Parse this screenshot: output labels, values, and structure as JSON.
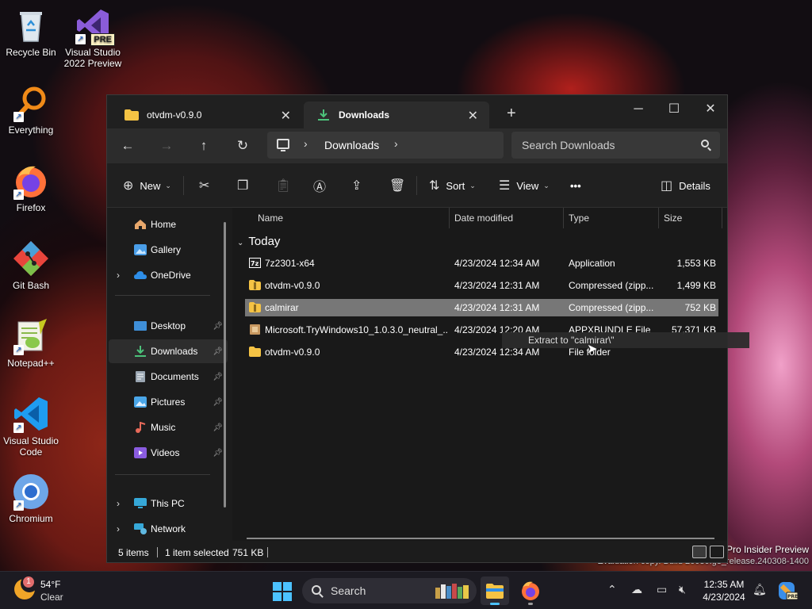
{
  "desktop": {
    "icons": [
      {
        "label": "Recycle Bin"
      },
      {
        "label": "Visual Studio 2022 Preview",
        "line1": "Visual Studio",
        "line2": "2022 Preview",
        "badge": "PRE"
      },
      {
        "label": "Everything"
      },
      {
        "label": "Firefox"
      },
      {
        "label": "Git Bash"
      },
      {
        "label": "Notepad++"
      },
      {
        "label": "Visual Studio Code",
        "line1": "Visual Studio",
        "line2": "Code"
      },
      {
        "label": "Chromium"
      }
    ],
    "watermark_line1": "Pro Insider Preview",
    "watermark_line2": "Evaluation copy. Build 26080.ge_release.240308-1400"
  },
  "explorer": {
    "tabs": [
      {
        "label": "otvdm-v0.9.0",
        "icon": "folder-icon",
        "active": false
      },
      {
        "label": "Downloads",
        "icon": "download-icon",
        "active": true
      }
    ],
    "address": {
      "crumb": "Downloads"
    },
    "search": {
      "placeholder": "Search Downloads"
    },
    "toolbar": {
      "new_label": "New",
      "sort_label": "Sort",
      "view_label": "View",
      "more_label": "•••",
      "details_label": "Details"
    },
    "nav": {
      "home": "Home",
      "gallery": "Gallery",
      "onedrive": "OneDrive",
      "desktop": "Desktop",
      "downloads": "Downloads",
      "documents": "Documents",
      "pictures": "Pictures",
      "music": "Music",
      "videos": "Videos",
      "this_pc": "This PC",
      "network": "Network"
    },
    "columns": {
      "name": "Name",
      "date": "Date modified",
      "type": "Type",
      "size": "Size"
    },
    "group": "Today",
    "files": [
      {
        "name": "7z2301-x64",
        "date": "4/23/2024 12:34 AM",
        "type": "Application",
        "size": "1,553 KB",
        "icon": "app-icon"
      },
      {
        "name": "otvdm-v0.9.0",
        "date": "4/23/2024 12:31 AM",
        "type": "Compressed (zipp...",
        "size": "1,499 KB",
        "icon": "zip-folder-icon"
      },
      {
        "name": "calmirar",
        "date": "4/23/2024 12:31 AM",
        "type": "Compressed (zipp...",
        "size": "752 KB",
        "icon": "zip-folder-icon"
      },
      {
        "name": "Microsoft.TryWindows10_1.0.3.0_neutral_...",
        "date": "4/23/2024 12:20 AM",
        "type": "APPXBUNDLE File",
        "size": "57,371 KB",
        "icon": "package-icon"
      },
      {
        "name": "otvdm-v0.9.0",
        "date": "4/23/2024 12:34 AM",
        "type": "File folder",
        "size": "",
        "icon": "folder-icon"
      }
    ],
    "drag_tooltip": "Extract to \"calmirar\\\"",
    "status": {
      "items": "5 items",
      "selected": "1 item selected",
      "size": "751 KB"
    }
  },
  "taskbar": {
    "weather_temp": "54°F",
    "weather_cond": "Clear",
    "weather_badge": "1",
    "search_label": "Search",
    "time": "12:35 AM",
    "date": "4/23/2024"
  },
  "colors": {
    "accent": "#4cc2ff",
    "selected_row": "#777777",
    "window_bg": "#1c1c1c"
  }
}
